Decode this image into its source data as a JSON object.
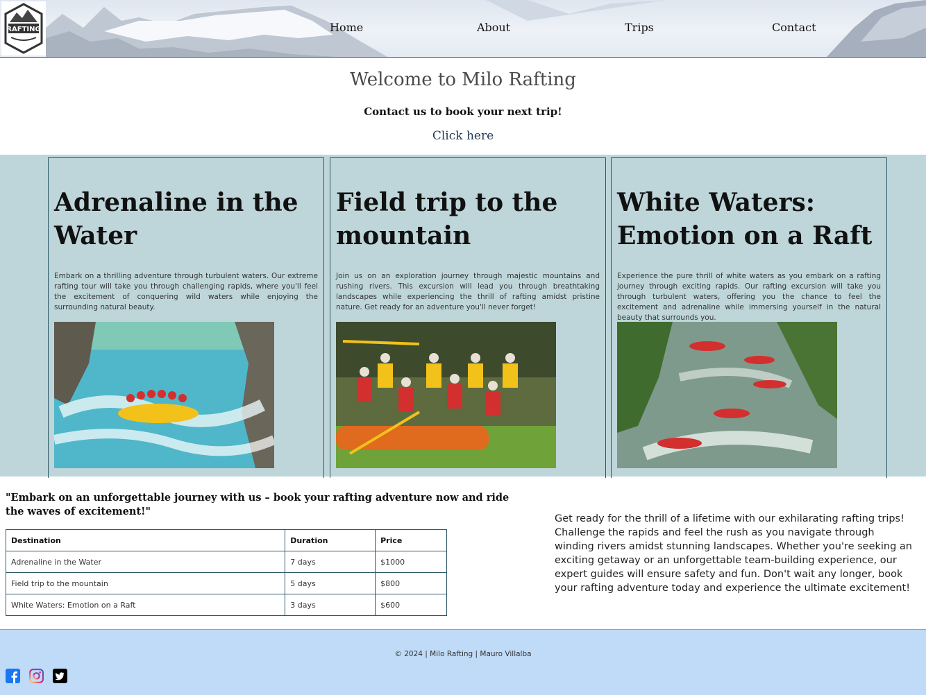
{
  "brand": {
    "logo_text": "RAFTING"
  },
  "nav": [
    {
      "label": "Home"
    },
    {
      "label": "About"
    },
    {
      "label": "Trips"
    },
    {
      "label": "Contact"
    }
  ],
  "intro": {
    "title": "Welcome to Milo Rafting",
    "subtitle": "Contact us to book your next trip!",
    "link": "Click here"
  },
  "cards": [
    {
      "title": "Adrenaline in the Water",
      "text": "Embark on a thrilling adventure through turbulent waters. Our extreme rafting tour will take you through challenging rapids, where you'll feel the excitement of conquering wild waters while enjoying the surrounding natural beauty.",
      "image_icon": "rafting-photo"
    },
    {
      "title": "Field trip to the mountain",
      "text": "Join us on an exploration journey through majestic mountains and rushing rivers. This excursion will lead you through breathtaking landscapes while experiencing the thrill of rafting amidst pristine nature. Get ready for an adventure you'll never forget!",
      "image_icon": "group-photo"
    },
    {
      "title": "White Waters: Emotion on a Raft",
      "text": "Experience the pure thrill of white waters as you embark on a rafting journey through exciting rapids. Our rafting excursion will take you through turbulent waters, offering you the chance to feel the excitement and adrenaline while immersing yourself in the natural beauty that surrounds you.",
      "image_icon": "rapids-photo"
    }
  ],
  "quote": "\"Embark on an unforgettable journey with us – book your rafting adventure now and ride the waves of excitement!\"",
  "table": {
    "headers": [
      "Destination",
      "Duration",
      "Price"
    ],
    "rows": [
      [
        "Adrenaline in the Water",
        "7 days",
        "$1000"
      ],
      [
        "Field trip to the mountain",
        "5 days",
        "$800"
      ],
      [
        "White Waters: Emotion on a Raft",
        "3 days",
        "$600"
      ]
    ]
  },
  "promo": "Get ready for the thrill of a lifetime with our exhilarating rafting trips! Challenge the rapids and feel the rush as you navigate through winding rivers amidst stunning landscapes. Whether you're seeking an exciting getaway or an unforgettable team-building experience, our expert guides will ensure safety and fun. Don't wait any longer, book your rafting adventure today and experience the ultimate excitement!",
  "footer": {
    "copyright": "© 2024 | Milo Rafting | Mauro Villalba",
    "social": [
      {
        "icon": "facebook-icon",
        "color": "#1877f2"
      },
      {
        "icon": "instagram-icon",
        "color": "#e1306c"
      },
      {
        "icon": "twitter-icon",
        "color": "#000000"
      }
    ]
  },
  "colors": {
    "card_band": "#bed6da",
    "footer_bg": "#bfdbf7",
    "border": "#2a5866"
  }
}
